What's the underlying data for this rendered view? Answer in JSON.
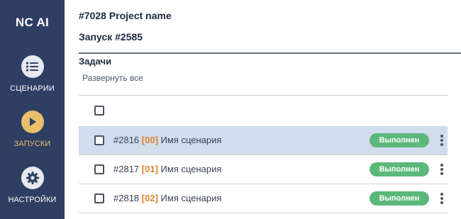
{
  "sidebar": {
    "logo": "NC AI",
    "items": [
      {
        "label": "СЦЕНАРИИ",
        "icon": "list-icon"
      },
      {
        "label": "ЗАПУСКИ",
        "icon": "play-icon",
        "active": true
      },
      {
        "label": "НАСТРОЙКИ",
        "icon": "gear-icon"
      }
    ]
  },
  "header": {
    "project_title": "#7028 Project name",
    "run_title": "Запуск #2585"
  },
  "tasks": {
    "heading": "Задачи",
    "expand_all": "Развернуть все",
    "rows": [
      {
        "id": "#2816",
        "index": "[00]",
        "name": "Имя сценария",
        "status": "Выполнен",
        "selected": true
      },
      {
        "id": "#2817",
        "index": "[01]",
        "name": "Имя сценария",
        "status": "Выполнен",
        "selected": false
      },
      {
        "id": "#2818",
        "index": "[02]",
        "name": "Имя сценария",
        "status": "Выполнен",
        "selected": false
      }
    ]
  },
  "colors": {
    "sidebar_bg": "#2f3e63",
    "active_accent": "#e8c06a",
    "status_success": "#5cb87a",
    "index_orange": "#e0842c",
    "selected_row": "#d1dcec"
  }
}
